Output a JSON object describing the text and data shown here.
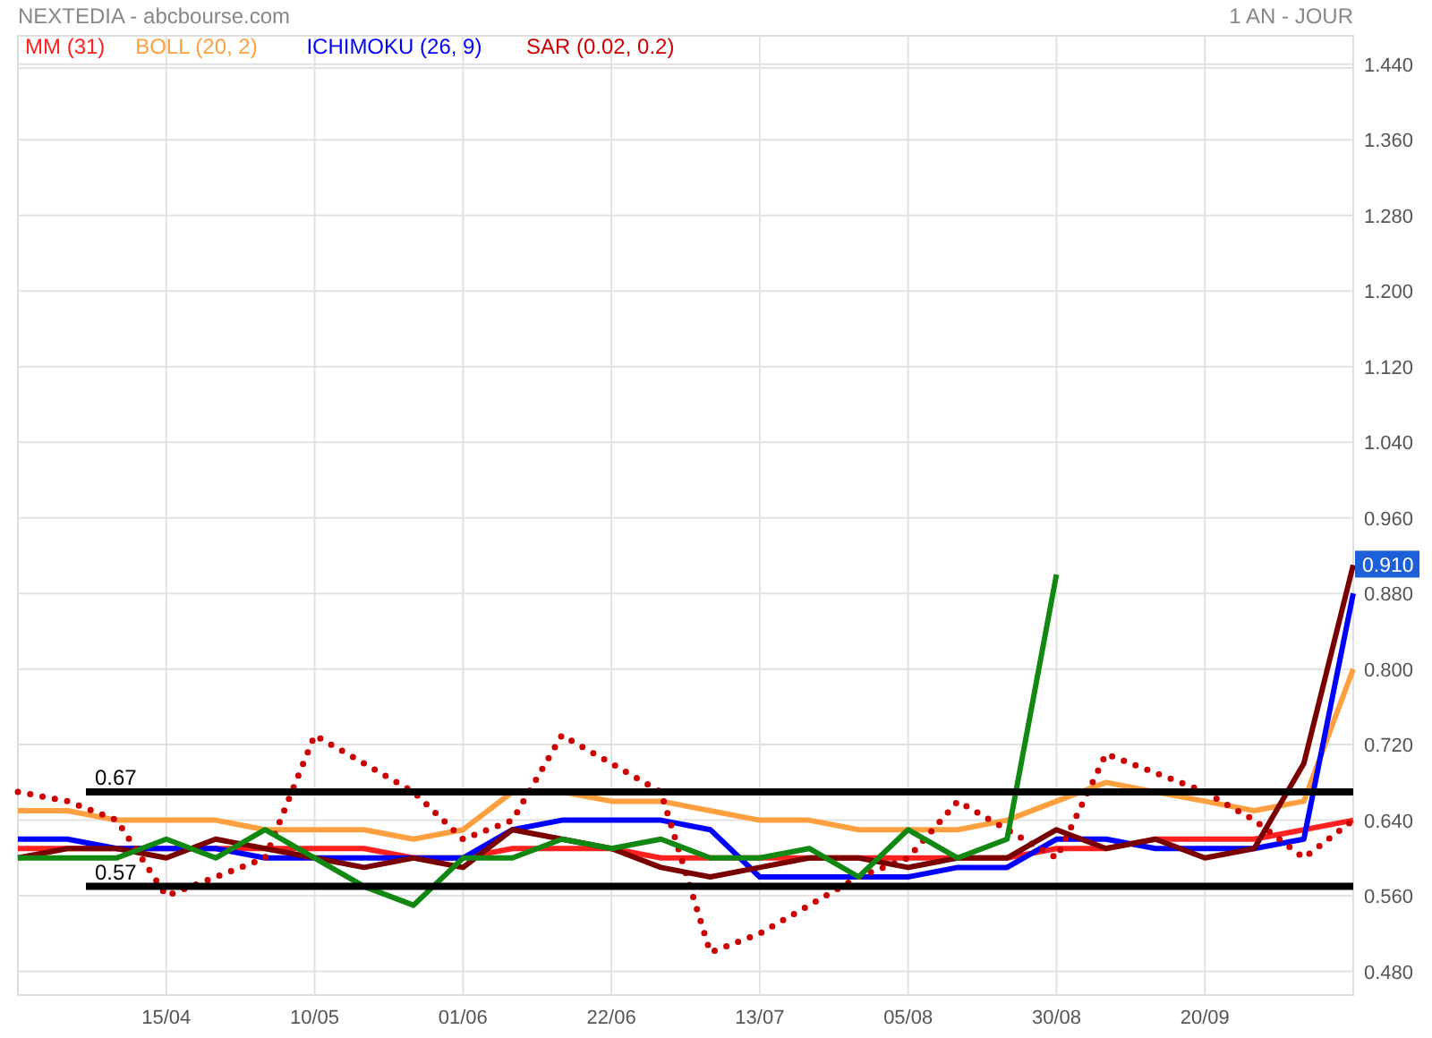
{
  "header": {
    "title": "NEXTEDIA - abcbourse.com",
    "period": "1 AN - JOUR"
  },
  "chart_data": {
    "type": "line",
    "ylim": [
      0.455,
      1.47
    ],
    "categories": [
      null,
      null,
      null,
      "15/04",
      null,
      null,
      "10/05",
      null,
      null,
      "01/06",
      null,
      null,
      "22/06",
      null,
      null,
      "13/07",
      null,
      null,
      "05/08",
      null,
      null,
      "30/08",
      null,
      null,
      "20/09",
      null,
      null,
      null
    ],
    "yticks": [
      {
        "value": 0.48,
        "label": "0.480"
      },
      {
        "value": 0.56,
        "label": "0.560"
      },
      {
        "value": 0.64,
        "label": "0.640"
      },
      {
        "value": 0.72,
        "label": "0.720"
      },
      {
        "value": 0.8,
        "label": "0.800"
      },
      {
        "value": 0.88,
        "label": "0.880"
      },
      {
        "value": 0.96,
        "label": "0.960"
      },
      {
        "value": 1.04,
        "label": "1.040"
      },
      {
        "value": 1.12,
        "label": "1.120"
      },
      {
        "value": 1.2,
        "label": "1.200"
      },
      {
        "value": 1.28,
        "label": "1.280"
      },
      {
        "value": 1.36,
        "label": "1.360"
      },
      {
        "value": 1.44,
        "label": "1.440"
      }
    ],
    "series": [
      {
        "name": "MM (31)",
        "color": "#ff2020",
        "values": [
          0.61,
          0.61,
          0.61,
          0.61,
          0.61,
          0.61,
          0.61,
          0.61,
          0.6,
          0.6,
          0.61,
          0.61,
          0.61,
          0.6,
          0.6,
          0.6,
          0.6,
          0.6,
          0.6,
          0.6,
          0.6,
          0.61,
          0.61,
          0.62,
          0.62,
          0.62,
          0.63,
          0.64
        ]
      },
      {
        "name": "BOLL (20, 2)",
        "color": "#ffa040",
        "values": [
          0.65,
          0.65,
          0.64,
          0.64,
          0.64,
          0.63,
          0.63,
          0.63,
          0.62,
          0.63,
          0.67,
          0.67,
          0.66,
          0.66,
          0.65,
          0.64,
          0.64,
          0.63,
          0.63,
          0.63,
          0.64,
          0.66,
          0.68,
          0.67,
          0.66,
          0.65,
          0.66,
          0.8
        ]
      },
      {
        "name": "ICHIMOKU (26, 9)",
        "color": "#0000ff",
        "values": [
          0.62,
          0.62,
          0.61,
          0.61,
          0.61,
          0.6,
          0.6,
          0.6,
          0.6,
          0.6,
          0.63,
          0.64,
          0.64,
          0.64,
          0.63,
          0.58,
          0.58,
          0.58,
          0.58,
          0.59,
          0.59,
          0.62,
          0.62,
          0.61,
          0.61,
          0.61,
          0.62,
          0.88
        ]
      },
      {
        "name": "SAR (0.02, 0.2)",
        "color": "#cc0000",
        "line_style": "dotted",
        "values": [
          0.67,
          0.66,
          0.64,
          0.56,
          0.58,
          0.6,
          0.73,
          0.7,
          0.67,
          0.62,
          0.64,
          0.73,
          0.7,
          0.67,
          0.5,
          0.52,
          0.55,
          0.58,
          0.6,
          0.66,
          0.63,
          0.6,
          0.71,
          0.69,
          0.67,
          0.64,
          0.6,
          0.64
        ]
      },
      {
        "color": "#7a0000",
        "values": [
          0.6,
          0.61,
          0.61,
          0.6,
          0.62,
          0.61,
          0.6,
          0.59,
          0.6,
          0.59,
          0.63,
          0.62,
          0.61,
          0.59,
          0.58,
          0.59,
          0.6,
          0.6,
          0.59,
          0.6,
          0.6,
          0.63,
          0.61,
          0.62,
          0.6,
          0.61,
          0.7,
          0.91
        ]
      },
      {
        "color": "#118811",
        "values": [
          0.6,
          0.6,
          0.6,
          0.62,
          0.6,
          0.63,
          0.6,
          0.57,
          0.55,
          0.6,
          0.6,
          0.62,
          0.61,
          0.62,
          0.6,
          0.6,
          0.61,
          0.58,
          0.63,
          0.6,
          0.62,
          0.9,
          null,
          null,
          null,
          null,
          null,
          null
        ]
      }
    ],
    "grid": true,
    "ref_lines": [
      {
        "axis": "y",
        "value": 0.67,
        "label": "0.67"
      },
      {
        "axis": "y",
        "value": 0.57,
        "label": "0.57"
      }
    ],
    "annotations": [
      {
        "text": "0.910",
        "y": 0.91
      }
    ]
  }
}
